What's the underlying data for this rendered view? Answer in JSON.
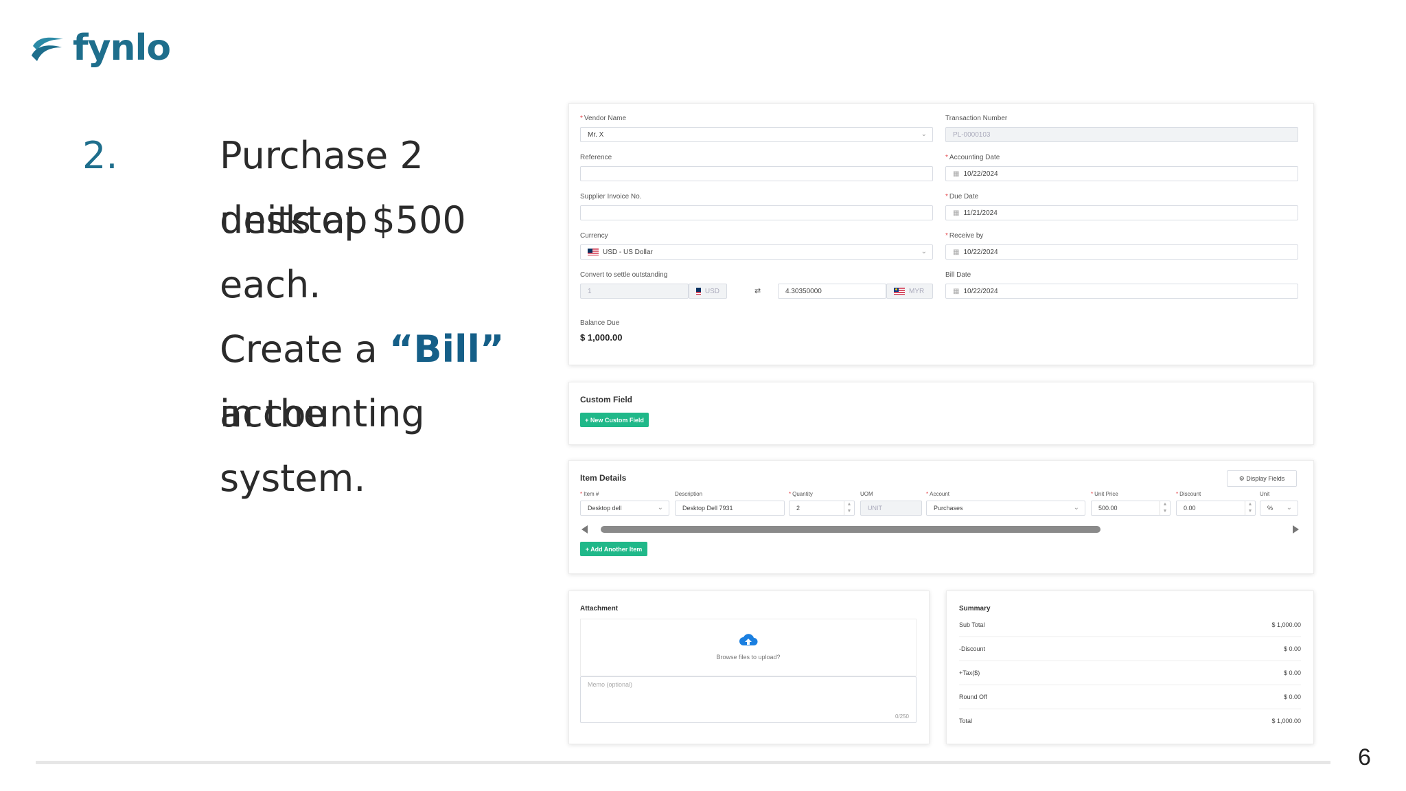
{
  "brand": {
    "name": "fynlo"
  },
  "slide": {
    "number": "2.",
    "line1": "Purchase 2 desktop",
    "line2": "units at $500 each.",
    "line3_pre": "Create a ",
    "line3_accent": "“Bill”",
    "line3_post": " in the",
    "line4": "accounting system.",
    "page_number": "6"
  },
  "bill_form": {
    "vendor_name": {
      "label": "Vendor Name",
      "value": "Mr. X"
    },
    "transaction_number": {
      "label": "Transaction Number",
      "value": "PL-0000103"
    },
    "reference": {
      "label": "Reference",
      "value": ""
    },
    "accounting_date": {
      "label": "Accounting Date",
      "value": "10/22/2024"
    },
    "supplier_invoice": {
      "label": "Supplier Invoice No.",
      "value": ""
    },
    "due_date": {
      "label": "Due Date",
      "value": "11/21/2024"
    },
    "currency": {
      "label": "Currency",
      "value": "USD - US Dollar"
    },
    "receive_by": {
      "label": "Receive by",
      "value": "10/22/2024"
    },
    "convert": {
      "label": "Convert to settle outstanding",
      "from_value": "1",
      "from_currency": "USD",
      "swap_symbol": "⇄",
      "to_value": "4.30350000",
      "to_currency": "MYR"
    },
    "bill_date": {
      "label": "Bill Date",
      "value": "10/22/2024"
    },
    "balance_due": {
      "label": "Balance Due",
      "value": "$ 1,000.00"
    }
  },
  "custom_field": {
    "title": "Custom Field",
    "button": "+ New Custom Field"
  },
  "item_details": {
    "title": "Item Details",
    "display_fields_button": "⚙ Display Fields",
    "columns": {
      "item": "Item #",
      "description": "Description",
      "quantity": "Quantity",
      "uom": "UOM",
      "account": "Account",
      "unit_price": "Unit Price",
      "discount": "Discount",
      "unit": "Unit"
    },
    "row": {
      "item": "Desktop dell",
      "description": "Desktop Dell 7931",
      "quantity": "2",
      "uom": "UNIT",
      "account": "Purchases",
      "unit_price": "500.00",
      "discount": "0.00",
      "unit": "%"
    },
    "add_button": "+ Add Another Item"
  },
  "attachment": {
    "title": "Attachment",
    "upload_text": "Browse files to upload?",
    "memo_placeholder": "Memo (optional)",
    "memo_counter": "0/250"
  },
  "summary": {
    "title": "Summary",
    "rows": [
      {
        "label": "Sub Total",
        "value": "$ 1,000.00"
      },
      {
        "label": "-Discount",
        "value": "$ 0.00"
      },
      {
        "label": "+Tax($)",
        "value": "$ 0.00"
      },
      {
        "label": "Round Off",
        "value": "$ 0.00"
      },
      {
        "label": "Total",
        "value": "$ 1,000.00"
      }
    ]
  },
  "colors": {
    "brand": "#1e6e8c",
    "accent": "#155f88",
    "button_green": "#20b889",
    "required": "#e5484d"
  }
}
